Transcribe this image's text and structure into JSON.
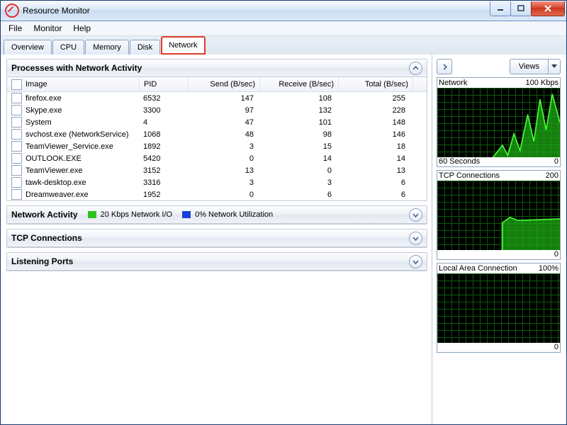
{
  "window": {
    "title": "Resource Monitor"
  },
  "menu": {
    "file": "File",
    "monitor": "Monitor",
    "help": "Help"
  },
  "tabs": {
    "overview": "Overview",
    "cpu": "CPU",
    "memory": "Memory",
    "disk": "Disk",
    "network": "Network"
  },
  "panels": {
    "processes": {
      "title": "Processes with Network Activity",
      "columns": {
        "image": "Image",
        "pid": "PID",
        "send": "Send (B/sec)",
        "receive": "Receive (B/sec)",
        "total": "Total (B/sec)"
      },
      "rows": [
        {
          "image": "firefox.exe",
          "pid": "6532",
          "send": "147",
          "recv": "108",
          "total": "255"
        },
        {
          "image": "Skype.exe",
          "pid": "3300",
          "send": "97",
          "recv": "132",
          "total": "228"
        },
        {
          "image": "System",
          "pid": "4",
          "send": "47",
          "recv": "101",
          "total": "148"
        },
        {
          "image": "svchost.exe (NetworkService)",
          "pid": "1068",
          "send": "48",
          "recv": "98",
          "total": "146"
        },
        {
          "image": "TeamViewer_Service.exe",
          "pid": "1892",
          "send": "3",
          "recv": "15",
          "total": "18"
        },
        {
          "image": "OUTLOOK.EXE",
          "pid": "5420",
          "send": "0",
          "recv": "14",
          "total": "14"
        },
        {
          "image": "TeamViewer.exe",
          "pid": "3152",
          "send": "13",
          "recv": "0",
          "total": "13"
        },
        {
          "image": "tawk-desktop.exe",
          "pid": "3316",
          "send": "3",
          "recv": "3",
          "total": "6"
        },
        {
          "image": "Dreamweaver.exe",
          "pid": "1952",
          "send": "0",
          "recv": "6",
          "total": "6"
        }
      ]
    },
    "activity": {
      "title": "Network Activity",
      "io_label": "20 Kbps Network I/O",
      "util_label": "0% Network Utilization"
    },
    "tcp": {
      "title": "TCP Connections"
    },
    "listening": {
      "title": "Listening Ports"
    }
  },
  "side": {
    "views": "Views",
    "charts": [
      {
        "title": "Network",
        "max": "100 Kbps",
        "footl": "60 Seconds",
        "footr": "0"
      },
      {
        "title": "TCP Connections",
        "max": "200",
        "footl": "",
        "footr": "0"
      },
      {
        "title": "Local Area Connection",
        "max": "100%",
        "footl": "",
        "footr": "0"
      }
    ]
  },
  "colors": {
    "green_swatch": "#2bc41e",
    "blue_swatch": "#1a3fd6"
  }
}
